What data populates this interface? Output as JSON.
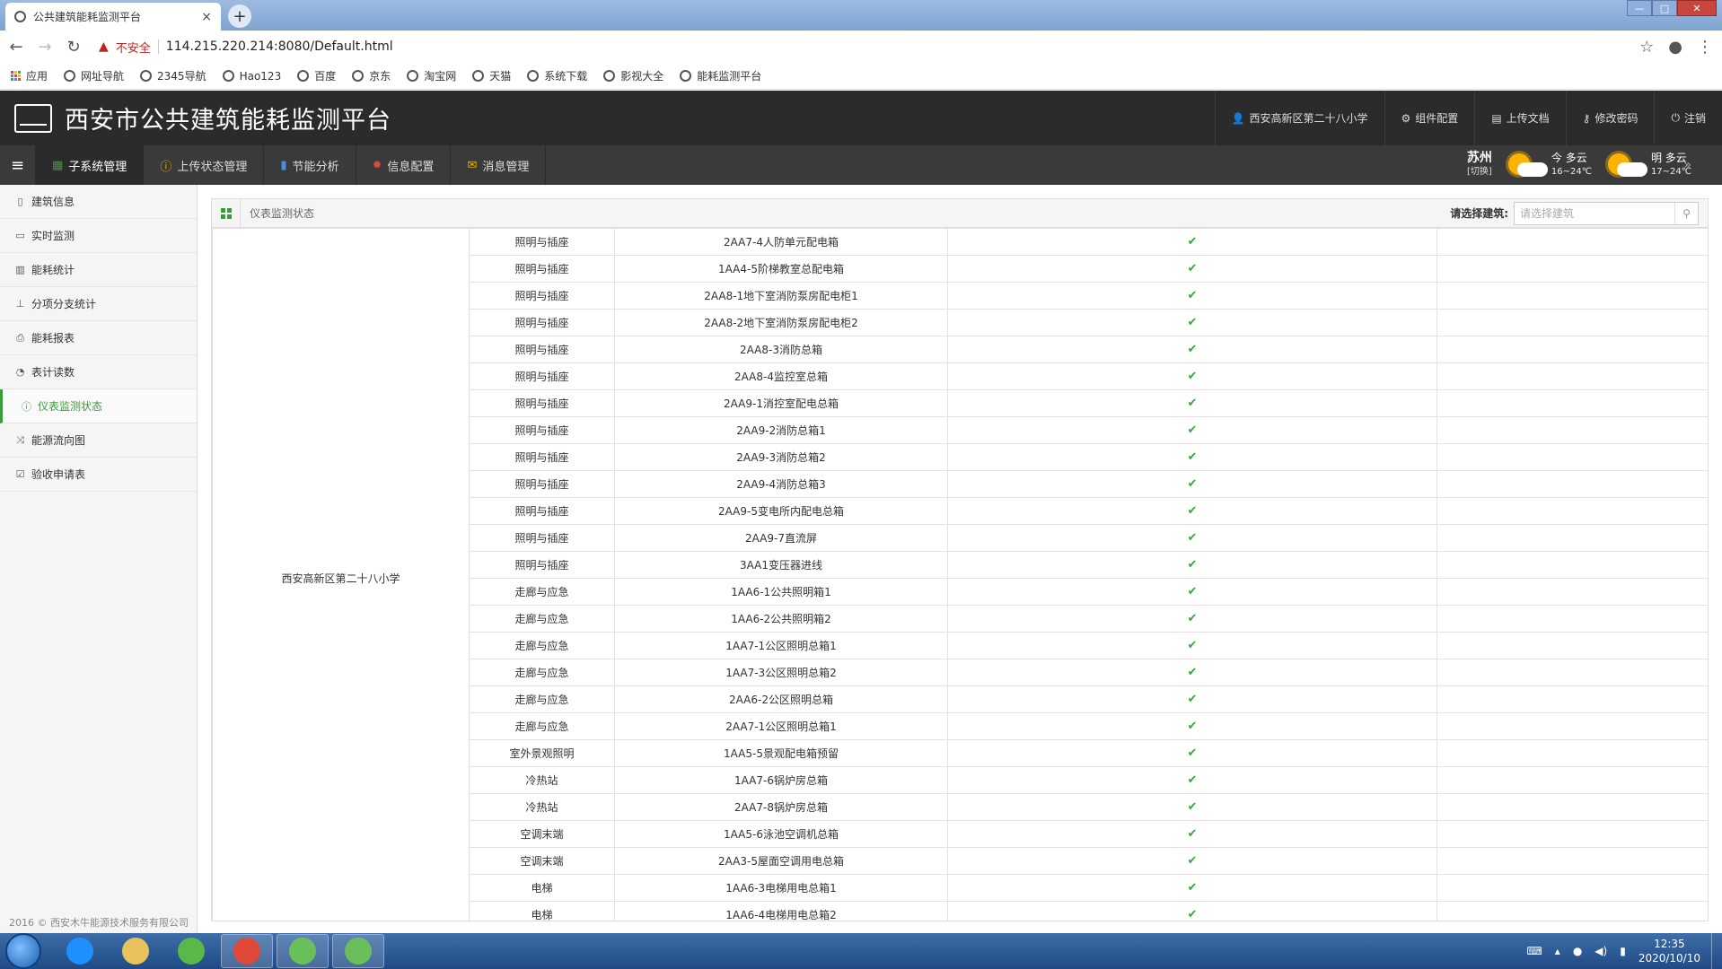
{
  "browser": {
    "tab_title": "公共建筑能耗监测平台",
    "tab_close": "×",
    "new_tab": "+",
    "insecure_label": "不安全",
    "url": "114.215.220.214:8080/Default.html",
    "bookmarks": [
      "应用",
      "网址导航",
      "2345导航",
      "Hao123",
      "百度",
      "京东",
      "淘宝网",
      "天猫",
      "系统下载",
      "影视大全",
      "能耗监测平台"
    ]
  },
  "header": {
    "title": "西安市公共建筑能耗监测平台",
    "links": [
      {
        "icon": "user-icon",
        "label": "西安高新区第二十八小学"
      },
      {
        "icon": "gear-icon",
        "label": "组件配置"
      },
      {
        "icon": "book-icon",
        "label": "上传文档"
      },
      {
        "icon": "key-icon",
        "label": "修改密码"
      },
      {
        "icon": "power-icon",
        "label": "注销"
      }
    ]
  },
  "menu": {
    "items": [
      {
        "icon": "grid-icon",
        "label": "子系统管理",
        "active": true,
        "color": "#3a9c3a"
      },
      {
        "icon": "info-circle-icon",
        "label": "上传状态管理",
        "active": false,
        "color": "#f0b400"
      },
      {
        "icon": "bar-chart-icon",
        "label": "节能分析",
        "active": false,
        "color": "#4a90e2"
      },
      {
        "icon": "cog-icon",
        "label": "信息配置",
        "active": false,
        "color": "#e04a3a"
      },
      {
        "icon": "envelope-icon",
        "label": "消息管理",
        "active": false,
        "color": "#f0b400"
      }
    ]
  },
  "weather": {
    "city": "苏州",
    "switch": "[切换]",
    "today": {
      "label": "今 多云",
      "temp": "16~24℃"
    },
    "tomorrow": {
      "label": "明 多云",
      "temp": "17~24℃"
    }
  },
  "sidebar": {
    "items": [
      {
        "icon": "building-icon",
        "label": "建筑信息",
        "active": false
      },
      {
        "icon": "monitor-icon",
        "label": "实时监测",
        "active": false
      },
      {
        "icon": "bar-chart-icon",
        "label": "能耗统计",
        "active": false
      },
      {
        "icon": "sitemap-icon",
        "label": "分项分支统计",
        "active": false
      },
      {
        "icon": "print-icon",
        "label": "能耗报表",
        "active": false
      },
      {
        "icon": "dashboard-icon",
        "label": "表计读数",
        "active": false
      },
      {
        "icon": "info-circle-icon",
        "label": "仪表监测状态",
        "active": true
      },
      {
        "icon": "random-icon",
        "label": "能源流向图",
        "active": false
      },
      {
        "icon": "check-square-icon",
        "label": "验收申请表",
        "active": false
      }
    ],
    "copyright": "2016 © 西安木牛能源技术服务有限公司"
  },
  "panel": {
    "title": "仪表监测状态",
    "picker_label": "请选择建筑:",
    "picker_placeholder": "请选择建筑"
  },
  "table": {
    "building": "西安高新区第二十八小学",
    "status_colors": {
      "ok": "#3aa63a"
    },
    "rows": [
      {
        "category": "照明与插座",
        "meter": "2AA7-4人防单元配电箱",
        "status": "✔"
      },
      {
        "category": "照明与插座",
        "meter": "1AA4-5阶梯教室总配电箱",
        "status": "✔"
      },
      {
        "category": "照明与插座",
        "meter": "2AA8-1地下室消防泵房配电柜1",
        "status": "✔"
      },
      {
        "category": "照明与插座",
        "meter": "2AA8-2地下室消防泵房配电柜2",
        "status": "✔"
      },
      {
        "category": "照明与插座",
        "meter": "2AA8-3消防总箱",
        "status": "✔"
      },
      {
        "category": "照明与插座",
        "meter": "2AA8-4监控室总箱",
        "status": "✔"
      },
      {
        "category": "照明与插座",
        "meter": "2AA9-1消控室配电总箱",
        "status": "✔"
      },
      {
        "category": "照明与插座",
        "meter": "2AA9-2消防总箱1",
        "status": "✔"
      },
      {
        "category": "照明与插座",
        "meter": "2AA9-3消防总箱2",
        "status": "✔"
      },
      {
        "category": "照明与插座",
        "meter": "2AA9-4消防总箱3",
        "status": "✔"
      },
      {
        "category": "照明与插座",
        "meter": "2AA9-5变电所内配电总箱",
        "status": "✔"
      },
      {
        "category": "照明与插座",
        "meter": "2AA9-7直流屏",
        "status": "✔"
      },
      {
        "category": "照明与插座",
        "meter": "3AA1变压器进线",
        "status": "✔"
      },
      {
        "category": "走廊与应急",
        "meter": "1AA6-1公共照明箱1",
        "status": "✔"
      },
      {
        "category": "走廊与应急",
        "meter": "1AA6-2公共照明箱2",
        "status": "✔"
      },
      {
        "category": "走廊与应急",
        "meter": "1AA7-1公区照明总箱1",
        "status": "✔"
      },
      {
        "category": "走廊与应急",
        "meter": "1AA7-3公区照明总箱2",
        "status": "✔"
      },
      {
        "category": "走廊与应急",
        "meter": "2AA6-2公区照明总箱",
        "status": "✔"
      },
      {
        "category": "走廊与应急",
        "meter": "2AA7-1公区照明总箱1",
        "status": "✔"
      },
      {
        "category": "室外景观照明",
        "meter": "1AA5-5景观配电箱预留",
        "status": "✔"
      },
      {
        "category": "冷热站",
        "meter": "1AA7-6锅炉房总箱",
        "status": "✔"
      },
      {
        "category": "冷热站",
        "meter": "2AA7-8锅炉房总箱",
        "status": "✔"
      },
      {
        "category": "空调末端",
        "meter": "1AA5-6泳池空调机总箱",
        "status": "✔"
      },
      {
        "category": "空调末端",
        "meter": "2AA3-5屋面空调用电总箱",
        "status": "✔"
      },
      {
        "category": "电梯",
        "meter": "1AA6-3电梯用电总箱1",
        "status": "✔"
      },
      {
        "category": "电梯",
        "meter": "1AA6-4电梯用电总箱2",
        "status": "✔"
      }
    ]
  },
  "taskbar": {
    "apps": [
      {
        "icon": "ie-icon",
        "color": "#1e90ff",
        "open": false
      },
      {
        "icon": "folder-icon",
        "color": "#e8c25a",
        "open": false
      },
      {
        "icon": "refresh-app-icon",
        "color": "#58b848",
        "open": false
      },
      {
        "icon": "chrome-icon",
        "color": "#e0483a",
        "open": true
      },
      {
        "icon": "app-22-icon",
        "color": "#6bbf5a",
        "open": true
      },
      {
        "icon": "app-21-icon",
        "color": "#6bbf5a",
        "open": true
      }
    ],
    "time": "12:35",
    "date": "2020/10/10"
  }
}
